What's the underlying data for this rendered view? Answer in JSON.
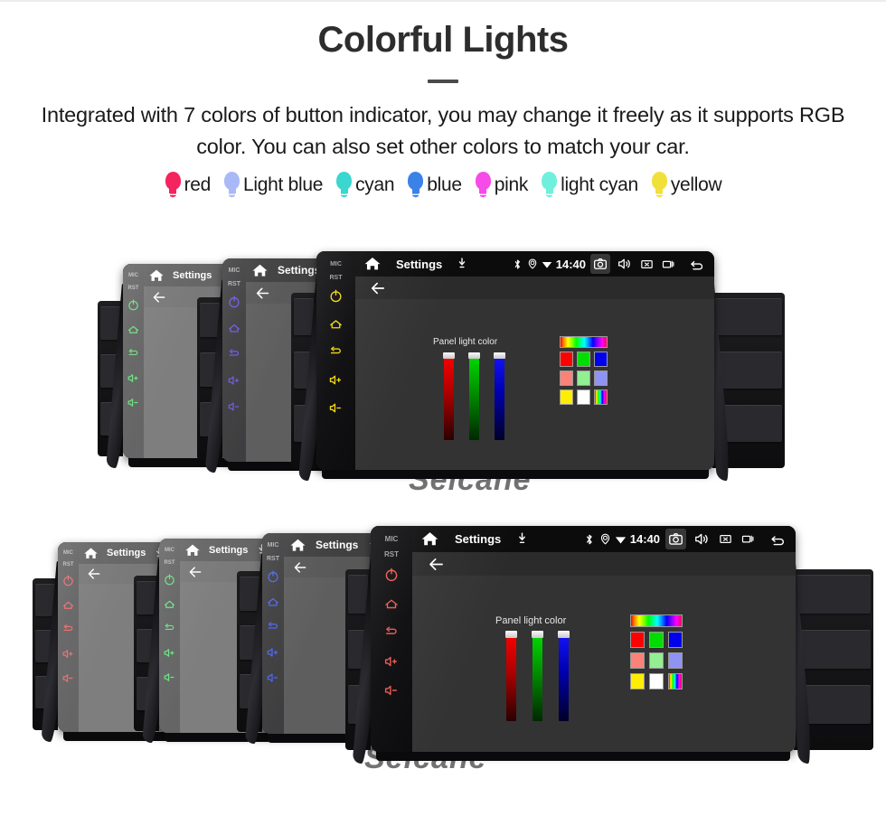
{
  "header": {
    "title": "Colorful Lights",
    "subtitle": "Integrated with 7 colors of button indicator, you may change it freely as it supports RGB color. You can also set other colors to match your car."
  },
  "legend": {
    "items": [
      {
        "label": "red",
        "color": "#F4245E"
      },
      {
        "label": "Light blue",
        "color": "#A9B9F7"
      },
      {
        "label": "cyan",
        "color": "#3BD6CF"
      },
      {
        "label": "blue",
        "color": "#3B82E8"
      },
      {
        "label": "pink",
        "color": "#F64BE8"
      },
      {
        "label": "light cyan",
        "color": "#6FF0DC"
      },
      {
        "label": "yellow",
        "color": "#F2E03A"
      }
    ]
  },
  "screen": {
    "home_icon": "home-icon",
    "title": "Settings",
    "mic_icon": "microphone-icon",
    "status_icons": [
      "bluetooth-icon",
      "location-pin-icon",
      "wifi-icon"
    ],
    "time": "14:40",
    "nav_icons": [
      "camera-icon",
      "volume-icon",
      "close-box-icon",
      "recents-icon",
      "back-icon"
    ],
    "back_icon": "back-arrow-icon",
    "panel_label": "Panel light color",
    "sliders": [
      {
        "name": "red-slider",
        "color": "#ff0000",
        "value": 100
      },
      {
        "name": "green-slider",
        "color": "#00e000",
        "value": 100
      },
      {
        "name": "blue-slider",
        "color": "#1515ff",
        "value": 100
      }
    ],
    "swatches": {
      "gradient_bar": "rainbow-gradient",
      "rows": [
        [
          "#ff0000",
          "#00dd00",
          "#0000ee"
        ],
        [
          "#fb8278",
          "#92ef92",
          "#8e93f4"
        ],
        [
          "#ffee00",
          "#ffffff",
          "rainbow-stripe"
        ]
      ]
    }
  },
  "device": {
    "strip_labels": [
      "MIC",
      "RST"
    ],
    "strip_icons": [
      "power-icon",
      "home-icon",
      "back-icon",
      "volume-up-icon",
      "volume-down-icon"
    ]
  },
  "clusters": {
    "top": {
      "name": "top-device-row",
      "units": [
        {
          "name": "unit-green",
          "led": "#19d43a",
          "led_label": "green"
        },
        {
          "name": "unit-violet",
          "led": "#4a2bdd",
          "led_label": "blue"
        },
        {
          "name": "unit-yellow",
          "led": "#f2d60c",
          "led_label": "yellow"
        }
      ]
    },
    "bottom": {
      "name": "bottom-device-row",
      "units": [
        {
          "name": "unit-red",
          "led": "#e31b1b",
          "led_label": "red"
        },
        {
          "name": "unit-green",
          "led": "#19d43a",
          "led_label": "green"
        },
        {
          "name": "unit-blue",
          "led": "#1b3bf0",
          "led_label": "blue"
        },
        {
          "name": "unit-salmon",
          "led": "#e8564e",
          "led_label": "pink"
        }
      ]
    }
  },
  "watermarks": [
    {
      "name": "watermark-top",
      "text": "Seicane"
    },
    {
      "name": "watermark-bottom",
      "text": "Seicane"
    }
  ]
}
